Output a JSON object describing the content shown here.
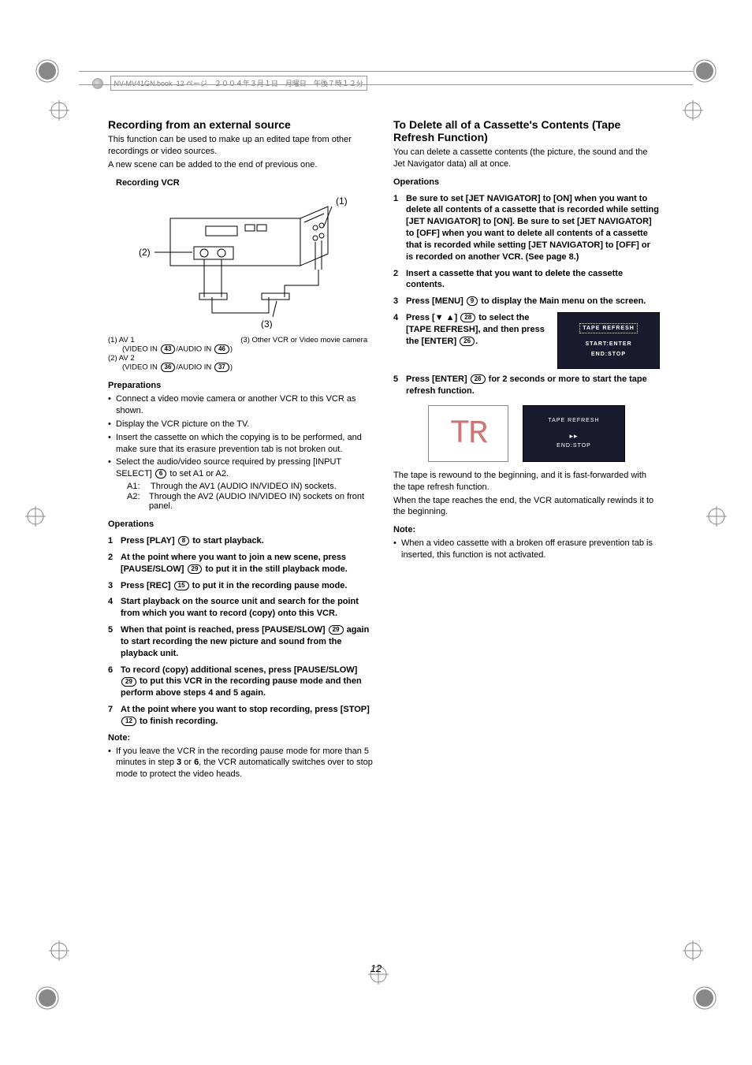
{
  "header": {
    "filename": "NV-MV41GN.book",
    "pageinfo": "12 ページ　２００４年３月１日　月曜日　午後７時１２分"
  },
  "left": {
    "title": "Recording from an external source",
    "intro1": "This function can be used to make up an edited tape from other recordings or video sources.",
    "intro2": "A new scene can be added to the end of previous one.",
    "fig_title": "Recording VCR",
    "callouts": {
      "c1": "(1)",
      "c2": "(2)",
      "c3": "(3)"
    },
    "fig_labels": {
      "l1_a": "(1) AV 1",
      "l1_b_pre": "(VIDEO IN ",
      "l1_b_mid": "43",
      "l1_b_mid2": "/AUDIO IN ",
      "l1_b_end": "46",
      "l1_b_close": ")",
      "l2_a": "(2) AV 2",
      "l2_b_pre": "(VIDEO IN ",
      "l2_b_mid": "36",
      "l2_b_mid2": "/AUDIO IN ",
      "l2_b_end": "37",
      "l2_b_close": ")",
      "l3": "(3) Other VCR or Video movie camera"
    },
    "prep_title": "Preparations",
    "prep": [
      "Connect a video movie camera or another VCR to this VCR as shown.",
      "Display the VCR picture on the TV.",
      "Insert the cassette on which the copying is to be performed, and make sure that its erasure prevention tab is not broken out.",
      "Select the audio/video source required by pressing [INPUT SELECT] __REF6__ to set A1 or A2."
    ],
    "a1_label": "A1:",
    "a1_text": "Through the AV1 (AUDIO IN/VIDEO IN) sockets.",
    "a2_label": "A2:",
    "a2_text": "Through the AV2 (AUDIO IN/VIDEO IN) sockets on front panel.",
    "ops_title": "Operations",
    "ops": [
      "Press [PLAY] __REF8__ to start playback.",
      "At the point where you want to join a new scene, press [PAUSE/SLOW] __REF29__ to put it in the still playback mode.",
      "Press [REC] __REF15__ to put it in the recording pause mode.",
      "Start playback on the source unit and search for the point from which you want to record (copy) onto this VCR.",
      "When that point is reached, press [PAUSE/SLOW] __REF29__ again to start recording the new picture and sound from the playback unit.",
      "To record (copy) additional scenes, press [PAUSE/SLOW] __REF29__ to put this VCR in the recording pause mode and then perform above steps 4 and 5 again.",
      "At the point where you want to stop recording, press [STOP] __REF12__ to finish recording."
    ],
    "note_title": "Note:",
    "note": "If you leave the VCR in the recording pause mode for more than 5 minutes in step 3 or 6, the VCR automatically switches over to stop mode to protect the video heads.",
    "refs": {
      "6": "6",
      "8": "8",
      "12": "12",
      "15": "15",
      "29": "29"
    }
  },
  "right": {
    "title": "To Delete all of a Cassette's Contents (Tape Refresh Function)",
    "intro": "You can delete a cassette contents (the picture, the sound and the Jet Navigator data) all at once.",
    "ops_title": "Operations",
    "op1": "Be sure to set [JET NAVIGATOR] to [ON] when you want to delete all contents of a cassette that is recorded while setting [JET NAVIGATOR] to [ON]. Be sure to set [JET NAVIGATOR] to [OFF] when you want to delete all contents of a cassette that is recorded while setting [JET NAVIGATOR] to [OFF] or is recorded on another VCR. (See page 8.)",
    "op2": "Insert a cassette that you want to delete the cassette contents.",
    "op3_pre": "Press [MENU] ",
    "op3_ref": "9",
    "op3_post": " to display the Main menu on the screen.",
    "op4_pre": "Press [▼ ▲] ",
    "op4_ref": "28",
    "op4_mid": " to select the [TAPE REFRESH], and then press the [ENTER] ",
    "op4_ref2": "26",
    "op4_post": ".",
    "op5_pre": "Press [ENTER] ",
    "op5_ref": "26",
    "op5_post": " for 2 seconds or more to start the tape refresh function.",
    "osd1": {
      "line1": "TAPE REFRESH",
      "line2": "START:ENTER",
      "line3": "END:STOP"
    },
    "osd2": {
      "line1": "TAPE REFRESH",
      "line2": "END:STOP"
    },
    "tr_display": "TR",
    "follow1": "The tape is rewound to the beginning, and it is fast-forwarded with the tape refresh function.",
    "follow2": "When the tape reaches the end, the VCR automatically rewinds it to the beginning.",
    "note_title": "Note:",
    "note": "When a video cassette with a broken off erasure prevention tab is inserted, this function is not activated."
  },
  "page_number": "12"
}
